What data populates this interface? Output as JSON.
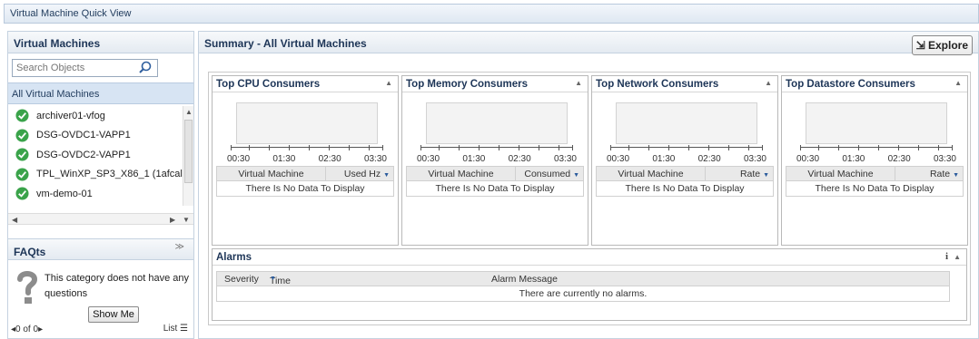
{
  "window": {
    "title": "Virtual Machine Quick View"
  },
  "left": {
    "header": "Virtual Machines",
    "search_placeholder": "Search Objects",
    "all_label": "All Virtual Machines",
    "vms": [
      {
        "name": "archiver01-vfog"
      },
      {
        "name": "DSG-OVDC1-VAPP1"
      },
      {
        "name": "DSG-OVDC2-VAPP1"
      },
      {
        "name": "TPL_WinXP_SP3_X86_1 (1afcal"
      },
      {
        "name": "vm-demo-01"
      }
    ],
    "status_color": "#3aa34a"
  },
  "faqs": {
    "header": "FAQts",
    "text": "This category does not have any questions",
    "show_me": "Show Me",
    "pager": "0 of 0",
    "list": "List"
  },
  "main": {
    "header": "Summary - All Virtual Machines",
    "explore": "Explore",
    "cards": [
      {
        "title": "Top CPU Consumers",
        "col1": "Virtual Machine",
        "col2": "Used Hz",
        "empty": "There Is No Data To Display",
        "ticks": [
          "00:30",
          "01:30",
          "02:30",
          "03:30"
        ]
      },
      {
        "title": "Top Memory Consumers",
        "col1": "Virtual Machine",
        "col2": "Consumed",
        "empty": "There Is No Data To Display",
        "ticks": [
          "00:30",
          "01:30",
          "02:30",
          "03:30"
        ]
      },
      {
        "title": "Top Network Consumers",
        "col1": "Virtual Machine",
        "col2": "Rate",
        "empty": "There Is No Data To Display",
        "ticks": [
          "00:30",
          "01:30",
          "02:30",
          "03:30"
        ]
      },
      {
        "title": "Top Datastore Consumers",
        "col1": "Virtual Machine",
        "col2": "Rate",
        "empty": "There Is No Data To Display",
        "ticks": [
          "00:30",
          "01:30",
          "02:30",
          "03:30"
        ]
      }
    ],
    "alarms": {
      "title": "Alarms",
      "info": "i",
      "col_severity": "Severity",
      "col_time": "Time",
      "col_message": "Alarm Message",
      "empty": "There are currently no alarms."
    }
  }
}
